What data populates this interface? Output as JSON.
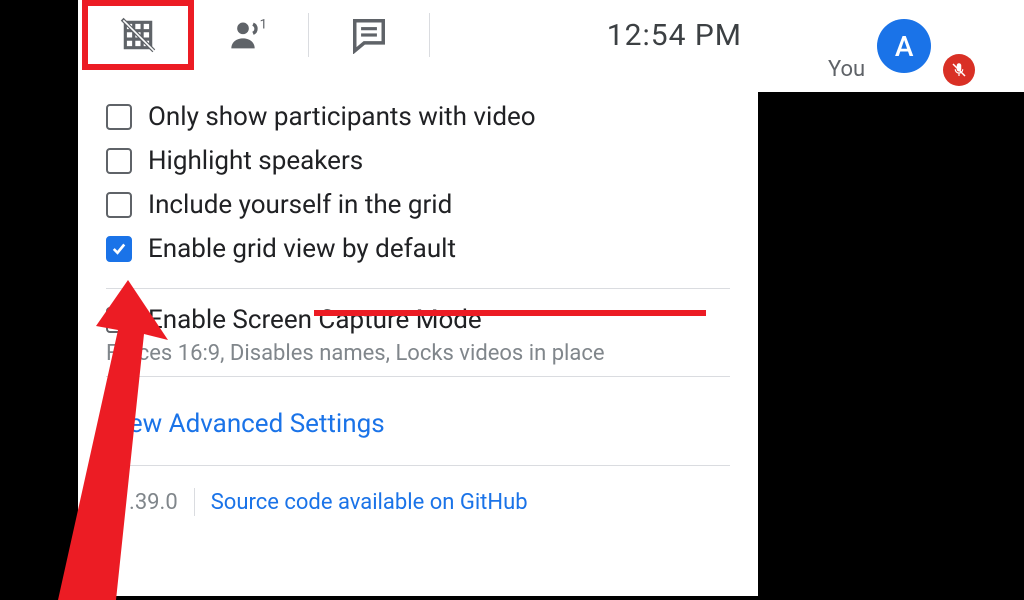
{
  "toolbar": {
    "grid_icon": "grid-off-icon",
    "people_count": "1"
  },
  "clock": "12:54 PM",
  "options": [
    {
      "label": "Only show participants with video",
      "checked": false
    },
    {
      "label": "Highlight speakers",
      "checked": false
    },
    {
      "label": "Include yourself in the grid",
      "checked": false
    },
    {
      "label": "Enable grid view by default",
      "checked": true
    }
  ],
  "screen_capture": {
    "label": "Enable Screen Capture Mode",
    "caption": "Forces 16:9, Disables names, Locks videos in place",
    "checked": false
  },
  "advanced_link": "View Advanced Settings",
  "footer": {
    "version": "v1.39.0",
    "source_link": "Source code available on GitHub"
  },
  "user": {
    "you_label": "You",
    "avatar_letter": "A",
    "mic_muted": true
  },
  "colors": {
    "accent_blue": "#1a73e8",
    "highlight_red": "#ec1c24",
    "text_primary": "#202124",
    "text_secondary": "#5f6368",
    "danger_red": "#d93025"
  }
}
